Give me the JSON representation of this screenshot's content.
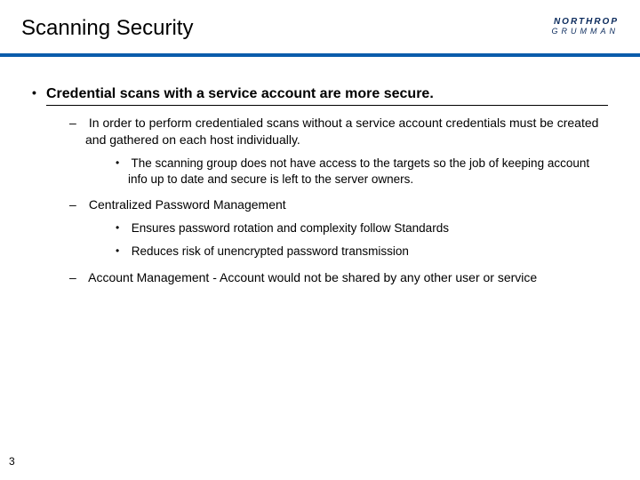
{
  "header": {
    "title": "Scanning Security",
    "logo_top": "NORTHROP",
    "logo_bottom": "GRUMMAN"
  },
  "colors": {
    "rule": "#0a5cab",
    "logo_text": "#0a2a5c"
  },
  "content": {
    "main": {
      "text": "Credential scans with a service account are more secure.",
      "children": [
        {
          "text": "In order to perform credentialed scans without a service account credentials must be created and gathered on each host individually.",
          "children": [
            {
              "text": "The scanning group does not have access to the targets so the job of keeping account info up to date and secure is left to the server owners."
            }
          ]
        },
        {
          "text": "Centralized Password Management",
          "children": [
            {
              "text": "Ensures password rotation and complexity follow Standards"
            },
            {
              "text": "Reduces risk of unencrypted password transmission"
            }
          ]
        },
        {
          "text": "Account Management - Account would not be shared by any other user or service",
          "children": []
        }
      ]
    }
  },
  "page_number": "3"
}
